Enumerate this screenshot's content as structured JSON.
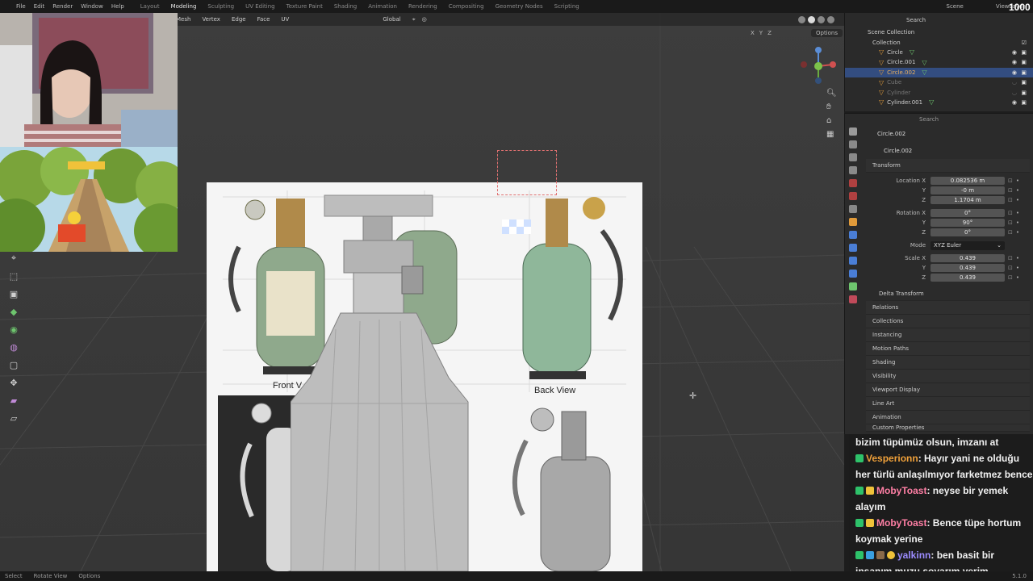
{
  "topbar": {
    "menu": [
      "File",
      "Edit",
      "Render",
      "Window",
      "Help"
    ],
    "workspaces": [
      "Layout",
      "Modeling",
      "Sculpting",
      "UV Editing",
      "Texture Paint",
      "Shading",
      "Animation",
      "Rendering",
      "Compositing",
      "Geometry Nodes",
      "Scripting"
    ],
    "active_workspace": "Modeling",
    "scene": "Scene",
    "view_layer": "ViewLayer",
    "counter": "1000"
  },
  "viewport_header": {
    "menus": [
      "Mesh",
      "Vertex",
      "Edge",
      "Face",
      "UV"
    ],
    "orientation": "Global",
    "axes": [
      "X",
      "Y",
      "Z"
    ],
    "options": "Options"
  },
  "reference": {
    "front_label": "Front V",
    "back_label": "Back View"
  },
  "outliner": {
    "scene_collection": "Scene Collection",
    "collection": "Collection",
    "search_placeholder": "Search",
    "items": [
      {
        "name": "Circle",
        "state": "normal"
      },
      {
        "name": "Circle.001",
        "state": "normal"
      },
      {
        "name": "Circle.002",
        "state": "selected"
      },
      {
        "name": "Cube",
        "state": "hidden"
      },
      {
        "name": "Cylinder",
        "state": "hidden"
      },
      {
        "name": "Cylinder.001",
        "state": "normal"
      }
    ]
  },
  "properties": {
    "search_placeholder": "Search",
    "object_name": "Circle.002",
    "object_field": "Circle.002",
    "transform_title": "Transform",
    "location": {
      "label": "Location X",
      "x": "0.082536 m",
      "y": "-0 m",
      "z": "1.1704 m"
    },
    "rotation": {
      "label": "Rotation X",
      "x": "0°",
      "y": "90°",
      "z": "0°"
    },
    "mode": {
      "label": "Mode",
      "value": "XYZ Euler"
    },
    "scale": {
      "label": "Scale X",
      "x": "0.439",
      "y": "0.439",
      "z": "0.439"
    },
    "y_label": "Y",
    "z_label": "Z",
    "sections": [
      "Delta Transform",
      "Relations",
      "Collections",
      "Instancing",
      "Motion Paths",
      "Shading",
      "Visibility",
      "Viewport Display",
      "Line Art",
      "Animation",
      "Custom Properties"
    ]
  },
  "chat": {
    "lines": [
      {
        "user": "",
        "color": "#f2f2f2",
        "text": "bizim tüpümüz olsun, imzanı at"
      },
      {
        "user": "Vesperionn",
        "color": "#f0a13a",
        "text": ": Hayır yani ne olduğu her türlü anlaşılmıyor farketmez bence"
      },
      {
        "user": "MobyToast",
        "color": "#ff7fa5",
        "text": ": neyse bir yemek alayım"
      },
      {
        "user": "MobyToast",
        "color": "#ff7fa5",
        "text": ": Bence tüpe hortum koymak yerine"
      },
      {
        "user": "yalkinn",
        "color": "#9c8cff",
        "text": ": ben basit bir insanım muzu soyarım yerim"
      }
    ]
  },
  "statusbar": {
    "items": [
      "Select",
      "Rotate View",
      "Options"
    ],
    "version": "5.1.0"
  },
  "colors": {
    "selection": "#334d80",
    "accent_orange": "#e09a3a",
    "mesh_green": "#6ec56e"
  }
}
